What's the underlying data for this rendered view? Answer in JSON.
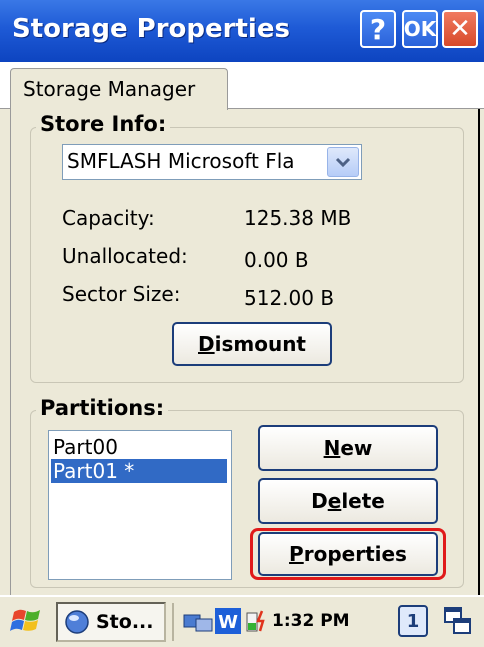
{
  "window": {
    "title": "Storage Properties",
    "help_label": "?",
    "ok_label": "OK",
    "close_label": "✕"
  },
  "tab": {
    "label": "Storage Manager"
  },
  "store_info": {
    "label": "Store Info:",
    "store_selected": "SMFLASH Microsoft Fla",
    "fields": [
      {
        "label": "Capacity:",
        "value": "125.38 MB"
      },
      {
        "label": "Unallocated:",
        "value": "0.00 B"
      },
      {
        "label": "Sector Size:",
        "value": "512.00 B"
      }
    ],
    "dismount_key": "D",
    "dismount_rest": "ismount"
  },
  "partitions": {
    "label": "Partitions:",
    "items": [
      "Part00",
      "Part01 *"
    ],
    "selected_index": 1,
    "new_key": "N",
    "new_rest": "ew",
    "delete_pre": "D",
    "delete_key": "e",
    "delete_rest": "lete",
    "properties_key": "P",
    "properties_rest": "roperties"
  },
  "taskbar": {
    "task_label": "Sto...",
    "clock": "1:32 PM",
    "input_label": "1"
  },
  "colors": {
    "titlebar": "#1e5ad6",
    "selection": "#316ac5",
    "highlight": "#e01a1a",
    "panel": "#ece9d8"
  },
  "icons": [
    "windows-flag-icon",
    "storage-app-icon",
    "network-icon",
    "word-icon",
    "battery-icon",
    "windows-switch-icon"
  ]
}
